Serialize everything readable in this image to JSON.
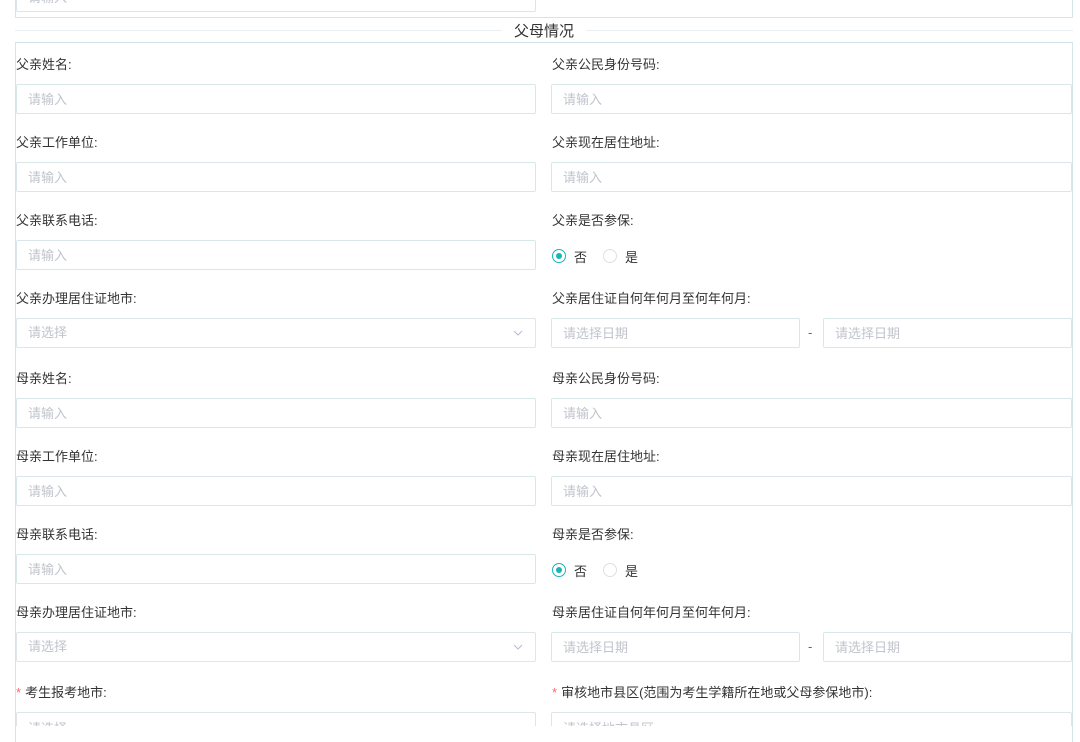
{
  "top": {
    "placeholder": "请输入"
  },
  "section_title": "父母情况",
  "placeholders": {
    "input": "请输入",
    "select": "请选择",
    "date": "请选择日期",
    "region": "请选择地市县区"
  },
  "father": {
    "name_label": "父亲姓名:",
    "id_label": "父亲公民身份号码:",
    "work_label": "父亲工作单位:",
    "address_label": "父亲现在居住地址:",
    "phone_label": "父亲联系电话:",
    "insured_label": "父亲是否参保:",
    "insured_options": [
      "否",
      "是"
    ],
    "insured_selected": "否",
    "permit_city_label": "父亲办理居住证地市:",
    "permit_period_label": "父亲居住证自何年何月至何年何月:"
  },
  "mother": {
    "name_label": "母亲姓名:",
    "id_label": "母亲公民身份号码:",
    "work_label": "母亲工作单位:",
    "address_label": "母亲现在居住地址:",
    "phone_label": "母亲联系电话:",
    "insured_label": "母亲是否参保:",
    "insured_options": [
      "否",
      "是"
    ],
    "insured_selected": "否",
    "permit_city_label": "母亲办理居住证地市:",
    "permit_period_label": "母亲居住证自何年何月至何年何月:"
  },
  "exam": {
    "city_label": "考生报考地市:",
    "region_label": "审核地市县区(范围为考生学籍所在地或父母参保地市):"
  },
  "date_separator": "-",
  "colors": {
    "accent": "#1ab4b8",
    "required": "#f56c6c",
    "border": "#d9e6ea",
    "placeholder": "#c0c4cc"
  }
}
